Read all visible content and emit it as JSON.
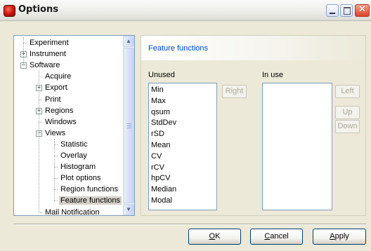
{
  "window": {
    "title": "Options",
    "icons": {
      "app": "app-icon",
      "minimize": "minimize-icon",
      "maximize": "maximize-icon",
      "close": "close-icon"
    },
    "close_glyph": "✕"
  },
  "tree": {
    "items": [
      {
        "label": "Experiment"
      },
      {
        "label": "Instrument",
        "expander": "+"
      },
      {
        "label": "Software",
        "expander": "−"
      },
      {
        "label": "Acquire"
      },
      {
        "label": "Export",
        "expander": "+"
      },
      {
        "label": "Print"
      },
      {
        "label": "Regions",
        "expander": "+"
      },
      {
        "label": "Windows"
      },
      {
        "label": "Views",
        "expander": "−"
      },
      {
        "label": "Statistic"
      },
      {
        "label": "Overlay"
      },
      {
        "label": "Histogram"
      },
      {
        "label": "Plot options"
      },
      {
        "label": "Region functions"
      },
      {
        "label": "Feature functions",
        "selected": true
      },
      {
        "label": "Mail Notification"
      }
    ],
    "scroll_up": "▲",
    "scroll_down": "▼"
  },
  "panel": {
    "title": "Feature functions",
    "unused_label": "Unused",
    "in_use_label": "In use",
    "unused_items": [
      "Min",
      "Max",
      "qsum",
      "StdDev",
      "rSD",
      "Mean",
      "CV",
      "rCV",
      "hpCV",
      "Median",
      "Modal"
    ],
    "in_use_items": [],
    "buttons": {
      "right": "Right",
      "left": "Left",
      "up": "Up",
      "down": "Down"
    }
  },
  "footer": {
    "ok": {
      "mnemonic": "O",
      "rest": "K"
    },
    "cancel": {
      "mnemonic": "C",
      "rest": "ancel"
    },
    "apply": {
      "mnemonic": "A",
      "rest": "pply"
    }
  }
}
